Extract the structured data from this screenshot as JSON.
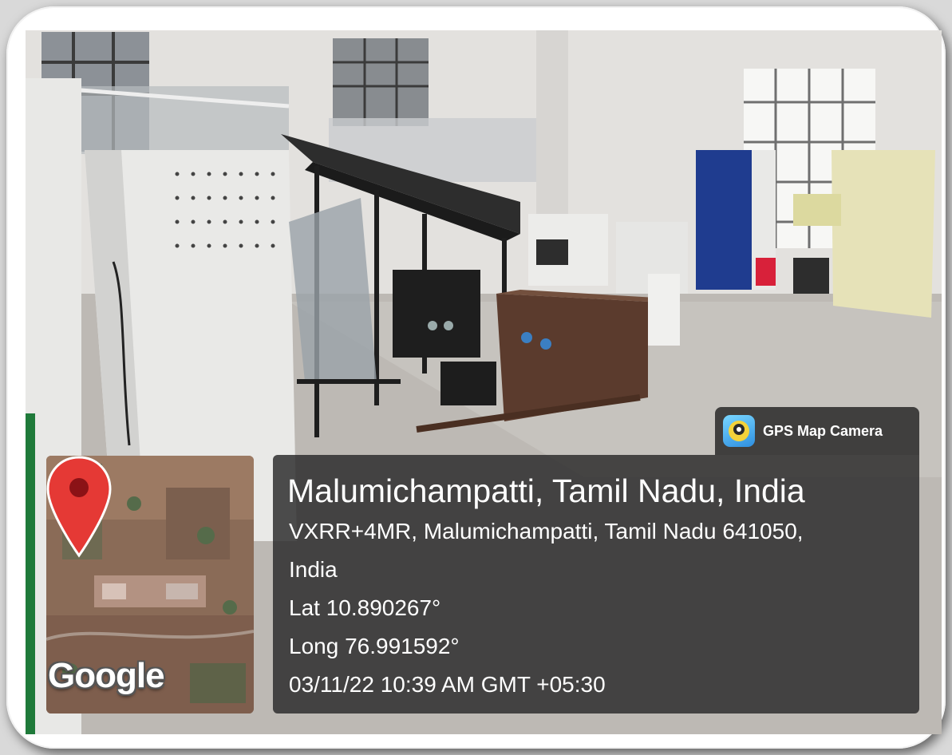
{
  "watermark": {
    "app_name": "GPS Map Camera",
    "app_icon": "gps-map-camera-app-icon"
  },
  "location": {
    "title": "Malumichampatti, Tamil Nadu, India",
    "address_line1": "VXRR+4MR, Malumichampatti, Tamil Nadu 641050,",
    "address_line2": "India",
    "latitude": "Lat 10.890267°",
    "longitude": "Long 76.991592°",
    "timestamp": "03/11/22 10:39 AM GMT +05:30"
  },
  "map": {
    "provider_logo": "Google",
    "pin_icon": "map-pin-icon",
    "pin_color": "#e53935"
  },
  "colors": {
    "overlay": "#282828",
    "frame": "#ffffff"
  }
}
